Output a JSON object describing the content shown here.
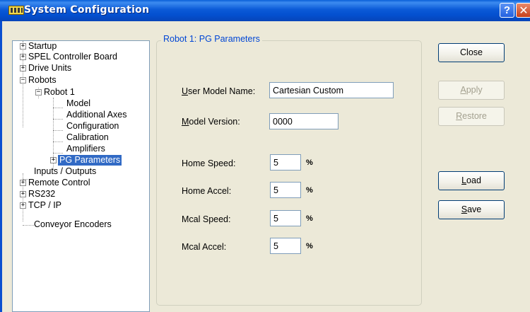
{
  "window": {
    "title": "System Configuration",
    "help_glyph": "?",
    "close_glyph": "✕"
  },
  "tree": {
    "items": [
      {
        "label": "Startup",
        "expander": "+"
      },
      {
        "label": "SPEL Controller Board",
        "expander": "+"
      },
      {
        "label": "Drive Units",
        "expander": "+"
      },
      {
        "label": "Robots",
        "expander": "−"
      },
      {
        "label": "Robot 1",
        "expander": "−"
      },
      {
        "label": "Model"
      },
      {
        "label": "Additional Axes"
      },
      {
        "label": "Configuration"
      },
      {
        "label": "Calibration"
      },
      {
        "label": "Amplifiers"
      },
      {
        "label": "PG Parameters",
        "expander": "+",
        "selected": true
      },
      {
        "label": "Inputs / Outputs"
      },
      {
        "label": "Remote Control",
        "expander": "+"
      },
      {
        "label": "RS232",
        "expander": "+"
      },
      {
        "label": "TCP / IP",
        "expander": "+"
      },
      {
        "label": "Conveyor Encoders"
      }
    ]
  },
  "panel": {
    "title": "Robot 1: PG Parameters",
    "user_model_name": {
      "label_u": "U",
      "label_rest": "ser Model Name:",
      "value": "Cartesian Custom"
    },
    "model_version": {
      "label_u": "M",
      "label_rest": "odel Version:",
      "value": "0000"
    },
    "home_speed": {
      "label": "Home Speed:",
      "value": "5",
      "unit": "%"
    },
    "home_accel": {
      "label": "Home Accel:",
      "value": "5",
      "unit": "%"
    },
    "mcal_speed": {
      "label": "Mcal Speed:",
      "value": "5",
      "unit": "%"
    },
    "mcal_accel": {
      "label": "Mcal Accel:",
      "value": "5",
      "unit": "%"
    }
  },
  "buttons": {
    "close": "Close",
    "apply_u": "A",
    "apply_rest": "pply",
    "restore_u": "R",
    "restore_rest": "estore",
    "load_u": "L",
    "load_rest": "oad",
    "save_u": "S",
    "save_rest": "ave"
  },
  "colors": {
    "titlebar": "#0450d0",
    "selection": "#316ac5",
    "group_title": "#0046d5"
  }
}
